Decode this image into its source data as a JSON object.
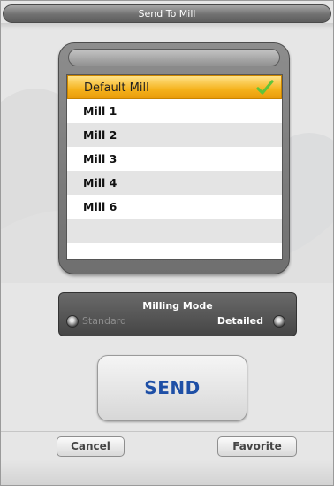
{
  "window": {
    "title": "Send To Mill"
  },
  "mill_list": {
    "items": [
      {
        "label": "Default Mill",
        "selected": true
      },
      {
        "label": "Mill 1",
        "selected": false
      },
      {
        "label": "Mill 2",
        "selected": false
      },
      {
        "label": "Mill 3",
        "selected": false
      },
      {
        "label": "Mill 4",
        "selected": false
      },
      {
        "label": "Mill 6",
        "selected": false
      }
    ],
    "selected_check_icon": "check-icon",
    "selected_color": "#f5b21c"
  },
  "milling_mode": {
    "title": "Milling Mode",
    "options": [
      "Standard",
      "Detailed"
    ],
    "selected": "Detailed"
  },
  "actions": {
    "send_label": "SEND",
    "send_color": "#1e4fa6",
    "cancel_label": "Cancel",
    "favorite_label": "Favorite"
  }
}
